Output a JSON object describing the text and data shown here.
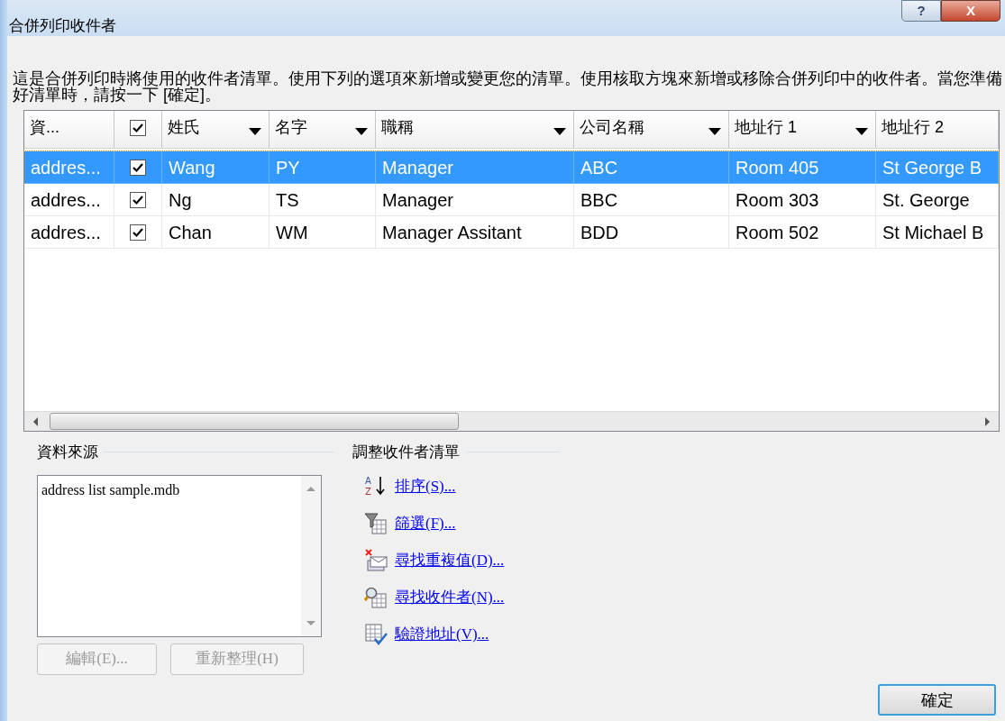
{
  "window": {
    "title": "合併列印收件者",
    "help_button": "?",
    "close_button": "X"
  },
  "description": "這是合併列印時將使用的收件者清單。使用下列的選項來新增或變更您的清單。使用核取方塊來新增或移除合併列印中的收件者。當您準備好清單時，請按一下 [確定]。",
  "table": {
    "columns": [
      {
        "kind": "text",
        "label": "資...",
        "dropdown": false
      },
      {
        "kind": "check",
        "checked": true
      },
      {
        "kind": "text",
        "label": "姓氏",
        "dropdown": true
      },
      {
        "kind": "text",
        "label": "名字",
        "dropdown": true
      },
      {
        "kind": "text",
        "label": "職稱",
        "dropdown": true
      },
      {
        "kind": "text",
        "label": "公司名稱",
        "dropdown": true
      },
      {
        "kind": "text",
        "label": "地址行 1",
        "dropdown": true
      },
      {
        "kind": "text",
        "label": "地址行 2",
        "dropdown": false
      }
    ],
    "rows": [
      {
        "selected": true,
        "checked": true,
        "cells": [
          "addres...",
          "",
          "Wang",
          "PY",
          "Manager",
          "ABC",
          "Room 405",
          "St George B"
        ]
      },
      {
        "selected": false,
        "checked": true,
        "cells": [
          "addres...",
          "",
          "Ng",
          "TS",
          "Manager",
          "BBC",
          "Room 303",
          "St. George"
        ]
      },
      {
        "selected": false,
        "checked": true,
        "cells": [
          "addres...",
          "",
          "Chan",
          "WM",
          "Manager Assitant",
          "BDD",
          "Room 502",
          "St Michael B"
        ]
      }
    ]
  },
  "data_source": {
    "heading": "資料來源",
    "items": [
      "address list sample.mdb"
    ],
    "buttons": [
      {
        "label": "編輯(E)...",
        "disabled": true
      },
      {
        "label": "重新整理(H)",
        "disabled": true
      }
    ]
  },
  "refine": {
    "heading": "調整收件者清單",
    "links": [
      {
        "kind": "sort",
        "label": "排序(S)...",
        "icon_letters": [
          "A",
          "Z"
        ]
      },
      {
        "kind": "filter",
        "label": "篩選(F)..."
      },
      {
        "kind": "duplicates",
        "label": "尋找重複值(D)..."
      },
      {
        "kind": "find",
        "label": "尋找收件者(N)..."
      },
      {
        "kind": "validate",
        "label": "驗證地址(V)..."
      }
    ]
  },
  "ok_button": "確定"
}
